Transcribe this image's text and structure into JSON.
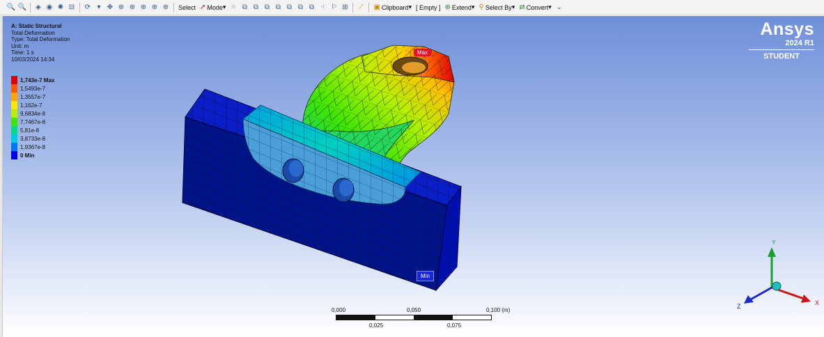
{
  "toolbar": {
    "select_label": "Select",
    "mode_label": "Mode",
    "clipboard_label": "Clipboard",
    "empty_label": "[ Empty ]",
    "extend_label": "Extend",
    "selectby_label": "Select By",
    "convert_label": "Convert"
  },
  "result": {
    "title": "A: Static Structural",
    "subtitle": "Total Deformation",
    "type": "Type: Total Deformation",
    "unit": "Unit: m",
    "time": "Time: 1 s",
    "date": "10/03/2024 14:34"
  },
  "legend": {
    "entries": [
      {
        "label": "1,743e-7 Max",
        "color": "#e0000a",
        "bold": true
      },
      {
        "label": "1,5493e-7",
        "color": "#ff5a00",
        "bold": false
      },
      {
        "label": "1,3557e-7",
        "color": "#ffa500",
        "bold": false
      },
      {
        "label": "1,162e-7",
        "color": "#ffe600",
        "bold": false
      },
      {
        "label": "9,6834e-8",
        "color": "#b4f000",
        "bold": false
      },
      {
        "label": "7,7467e-8",
        "color": "#3ee600",
        "bold": false
      },
      {
        "label": "5,81e-8",
        "color": "#00dc8c",
        "bold": false
      },
      {
        "label": "3,8733e-8",
        "color": "#00c8e6",
        "bold": false
      },
      {
        "label": "1,9367e-8",
        "color": "#0078f0",
        "bold": false
      },
      {
        "label": "0 Min",
        "color": "#0000e6",
        "bold": true
      }
    ]
  },
  "brand": {
    "name": "Ansys",
    "version": "2024 R1",
    "edition": "STUDENT"
  },
  "markers": {
    "max": "Max",
    "min": "Min"
  },
  "scale": {
    "top": [
      "0,000",
      "0,050",
      "0,100 (m)"
    ],
    "bottom": [
      "0,025",
      "0,075"
    ]
  },
  "triad": {
    "x": "X",
    "y": "Y",
    "z": "Z"
  }
}
